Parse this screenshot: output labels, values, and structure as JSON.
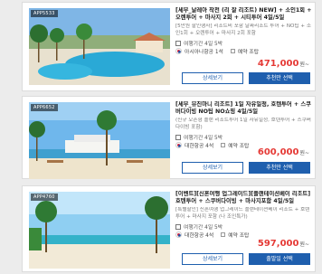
{
  "cards": [
    {
      "code": "APP5533",
      "title": "[세부_날레아 작전 (리 잘 리조트) NEW] + 소인1회 + 오렌투어 + 마사지 2회 + 시티투어 4일/5일",
      "desc": "[5만원 할인행사] 리조트비 포함 날짜리조트 투어 + NO팁 + 소인1회 + 오렌투어 + 마사지 2회 포함",
      "meta": "여행기간 4일 5박",
      "airline": "아시아나항공 1석",
      "seat": "예약 조탑",
      "price": "471,000",
      "won": "원~",
      "detail_label": "상세보기",
      "book_label": "추천만 선택"
    },
    {
      "code": "APP6652",
      "title": "[세부_뮤진마니 리조트] 1일 자유일정, 호텐투어 + 스쿠버다이빙 NO팁 NO쇼핑 4일/5일",
      "desc": "(신규 오픈형 플랜 리조트투어 1일 자유일정, 호텐투어 + 스쿠버다이빙 포함)",
      "meta": "여행기간 4일 5박",
      "airline": "대한항공 4석",
      "seat": "예약 조탑",
      "price": "600,000",
      "won": "원~",
      "detail_label": "상세보기",
      "book_label": "추천만 선택"
    },
    {
      "code": "APP4760",
      "title": "[이벤트][신혼여행 업그레이드][플랜테이션베이 리조트] 호텐투어 + 스쿠버다이빙 + 마사지포함 4일/5일",
      "desc": "[특별할인] 신혼여행 업그레이드 플랜테이션베이 리조트 + 호텐투어 + 마사지 포함 (나 조인특가)",
      "meta": "여행기간 4일 5박",
      "airline": "대한항공 4석",
      "seat": "예약 조탑",
      "price": "597,000",
      "won": "원~",
      "detail_label": "상세보기",
      "book_label": "출발일 선택"
    }
  ]
}
